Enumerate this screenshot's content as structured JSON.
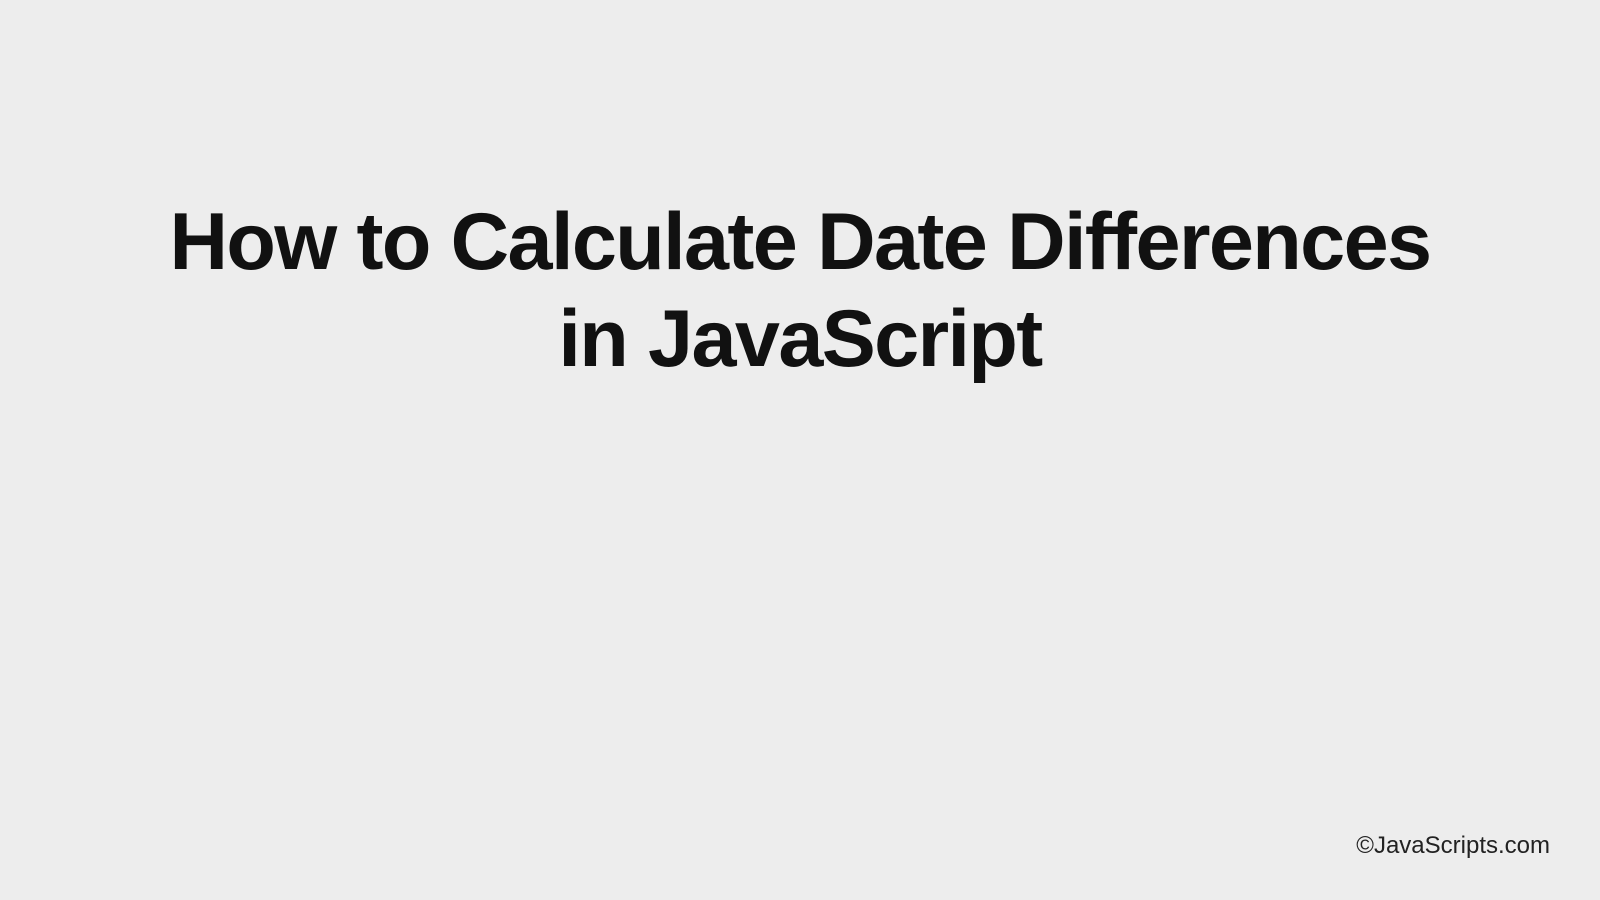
{
  "main": {
    "title": "How to Calculate Date Differences in JavaScript"
  },
  "footer": {
    "copyright": "©JavaScripts.com"
  }
}
